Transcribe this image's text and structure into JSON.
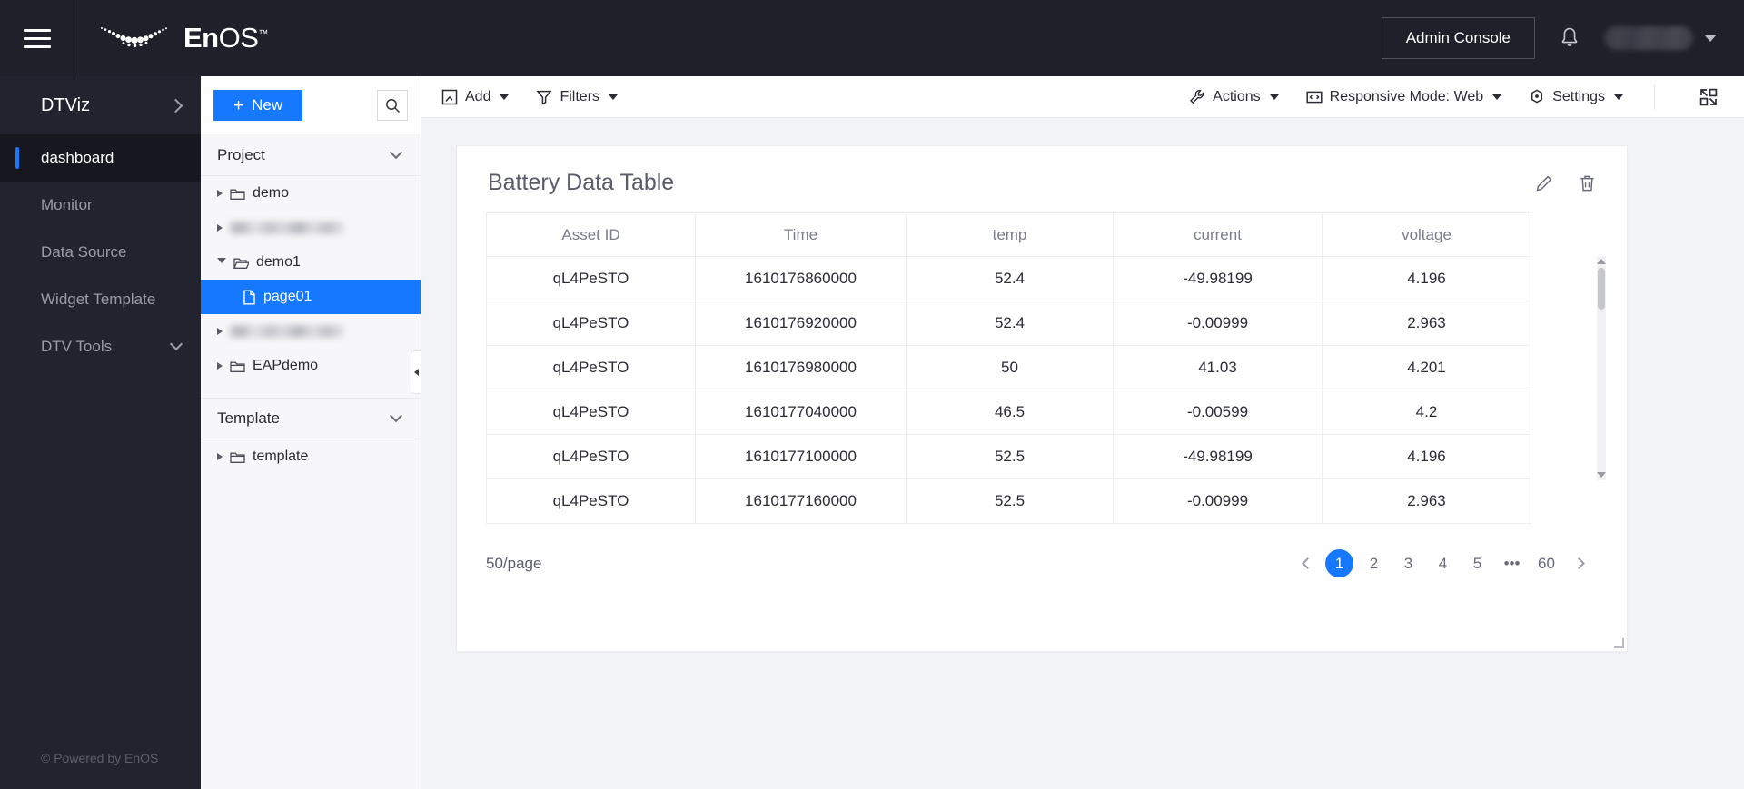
{
  "topbar": {
    "menu_icon": "hamburger-icon",
    "logo_text_bold": "En",
    "logo_text_light": "OS",
    "logo_tm": "™",
    "admin_console_label": "Admin Console",
    "notification_icon": "bell-icon",
    "user_name": "",
    "user_caret_icon": "chevron-down-icon"
  },
  "leftnav": {
    "header_label": "DTViz",
    "header_chevron_icon": "chevron-right-icon",
    "items": [
      {
        "label": "dashboard",
        "active": true,
        "has_chevron": false
      },
      {
        "label": "Monitor",
        "active": false,
        "has_chevron": false
      },
      {
        "label": "Data Source",
        "active": false,
        "has_chevron": false
      },
      {
        "label": "Widget Template",
        "active": false,
        "has_chevron": false
      },
      {
        "label": "DTV Tools",
        "active": false,
        "has_chevron": true
      }
    ],
    "footer": "© Powered by EnOS"
  },
  "tree": {
    "new_button_label": "New",
    "new_button_plus": "+",
    "search_icon": "search-icon",
    "sections": [
      {
        "title": "Project",
        "items": [
          {
            "label": "demo",
            "icon": "folder-icon",
            "state": "collapsed",
            "redacted": false,
            "selected": false,
            "indent": false
          },
          {
            "label": "",
            "icon": "folder-icon",
            "state": "collapsed",
            "redacted": true,
            "selected": false,
            "indent": false
          },
          {
            "label": "demo1",
            "icon": "folder-open-icon",
            "state": "expanded",
            "redacted": false,
            "selected": false,
            "indent": false
          },
          {
            "label": "page01",
            "icon": "file-icon",
            "state": "leaf",
            "redacted": false,
            "selected": true,
            "indent": true
          },
          {
            "label": "",
            "icon": "folder-icon",
            "state": "collapsed",
            "redacted": true,
            "selected": false,
            "indent": false
          },
          {
            "label": "EAPdemo",
            "icon": "folder-icon",
            "state": "collapsed",
            "redacted": false,
            "selected": false,
            "indent": false
          }
        ]
      },
      {
        "title": "Template",
        "items": [
          {
            "label": "template",
            "icon": "folder-icon",
            "state": "collapsed",
            "redacted": false,
            "selected": false,
            "indent": false
          }
        ]
      }
    ],
    "collapse_handle_icon": "collapse-panel-icon"
  },
  "toolbar": {
    "left": [
      {
        "label": "Add",
        "icon": "add-widget-icon",
        "caret": true
      },
      {
        "label": "Filters",
        "icon": "filter-icon",
        "caret": true
      }
    ],
    "right": [
      {
        "label": "Actions",
        "icon": "wrench-icon",
        "caret": true
      },
      {
        "label": "Responsive Mode: Web",
        "icon": "responsive-icon",
        "caret": true
      },
      {
        "label": "Settings",
        "icon": "gear-icon",
        "caret": true
      }
    ],
    "fullscreen_icon": "fullscreen-icon"
  },
  "widget": {
    "title": "Battery Data Table",
    "edit_icon": "pencil-icon",
    "delete_icon": "trash-icon",
    "table": {
      "columns": [
        "Asset ID",
        "Time",
        "temp",
        "current",
        "voltage"
      ],
      "rows": [
        [
          "qL4PeSTO",
          "1610176860000",
          "52.4",
          "-49.98199",
          "4.196"
        ],
        [
          "qL4PeSTO",
          "1610176920000",
          "52.4",
          "-0.00999",
          "2.963"
        ],
        [
          "qL4PeSTO",
          "1610176980000",
          "50",
          "41.03",
          "4.201"
        ],
        [
          "qL4PeSTO",
          "1610177040000",
          "46.5",
          "-0.00599",
          "4.2"
        ],
        [
          "qL4PeSTO",
          "1610177100000",
          "52.5",
          "-49.98199",
          "4.196"
        ],
        [
          "qL4PeSTO",
          "1610177160000",
          "52.5",
          "-0.00999",
          "2.963"
        ]
      ]
    },
    "pagination": {
      "page_size_label": "50/page",
      "prev_icon": "chevron-left-icon",
      "next_icon": "chevron-right-icon",
      "pages": [
        "1",
        "2",
        "3",
        "4",
        "5",
        "•••",
        "60"
      ],
      "current_page": "1"
    }
  },
  "colors": {
    "accent": "#1677ff",
    "topbar_bg": "#1f2029",
    "leftnav_bg": "#22232e",
    "canvas_bg": "#f2f3f6"
  }
}
